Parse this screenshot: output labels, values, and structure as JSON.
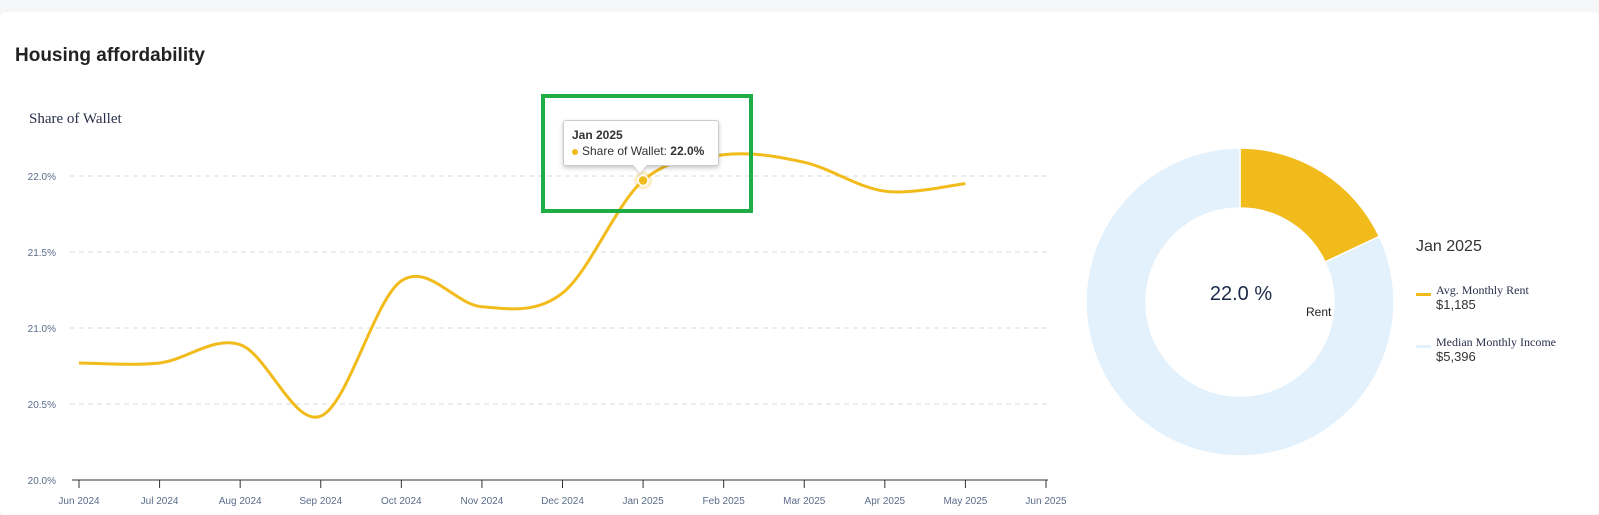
{
  "card": {
    "title": "Housing affordability"
  },
  "colors": {
    "series": "#f2bb1c",
    "income": "#e3f1fc",
    "grid": "#d6d9de",
    "axis": "#333333"
  },
  "chart_data": [
    {
      "type": "line",
      "title": "Share of Wallet",
      "x": [
        "Jun 2024",
        "Jul 2024",
        "Aug 2024",
        "Sep 2024",
        "Oct 2024",
        "Nov 2024",
        "Dec 2024",
        "Jan 2025",
        "Feb 2025",
        "Mar 2025",
        "Apr 2025",
        "May 2025"
      ],
      "x_ticks": [
        "Jun 2024",
        "Jul 2024",
        "Aug 2024",
        "Sep 2024",
        "Oct 2024",
        "Nov 2024",
        "Dec 2024",
        "Jan 2025",
        "Feb 2025",
        "Mar 2025",
        "Apr 2025",
        "May 2025",
        "Jun 2025"
      ],
      "series": [
        {
          "name": "Share of Wallet",
          "values": [
            20.77,
            20.77,
            20.89,
            20.42,
            21.31,
            21.14,
            21.23,
            21.97,
            22.14,
            22.09,
            21.9,
            21.95
          ]
        }
      ],
      "ylim": [
        20.0,
        22.0
      ],
      "y_ticks": [
        "20.0%",
        "20.5%",
        "21.0%",
        "21.5%",
        "22.0%"
      ],
      "grid": true,
      "highlighted_point": "Jan 2025",
      "tooltip": {
        "title": "Jan 2025",
        "label": "Share of Wallet: ",
        "value": "22.0%"
      }
    },
    {
      "type": "pie",
      "variant": "donut",
      "center_label": "22.0 %",
      "center_sublabel": "Rent",
      "legend_title": "Jan 2025",
      "legend_position": "right",
      "slices": [
        {
          "name": "Avg. Monthly Rent",
          "value": 1185,
          "display": "$1,185"
        },
        {
          "name": "Median Monthly Income",
          "value": 5396,
          "display": "$5,396"
        }
      ]
    }
  ]
}
